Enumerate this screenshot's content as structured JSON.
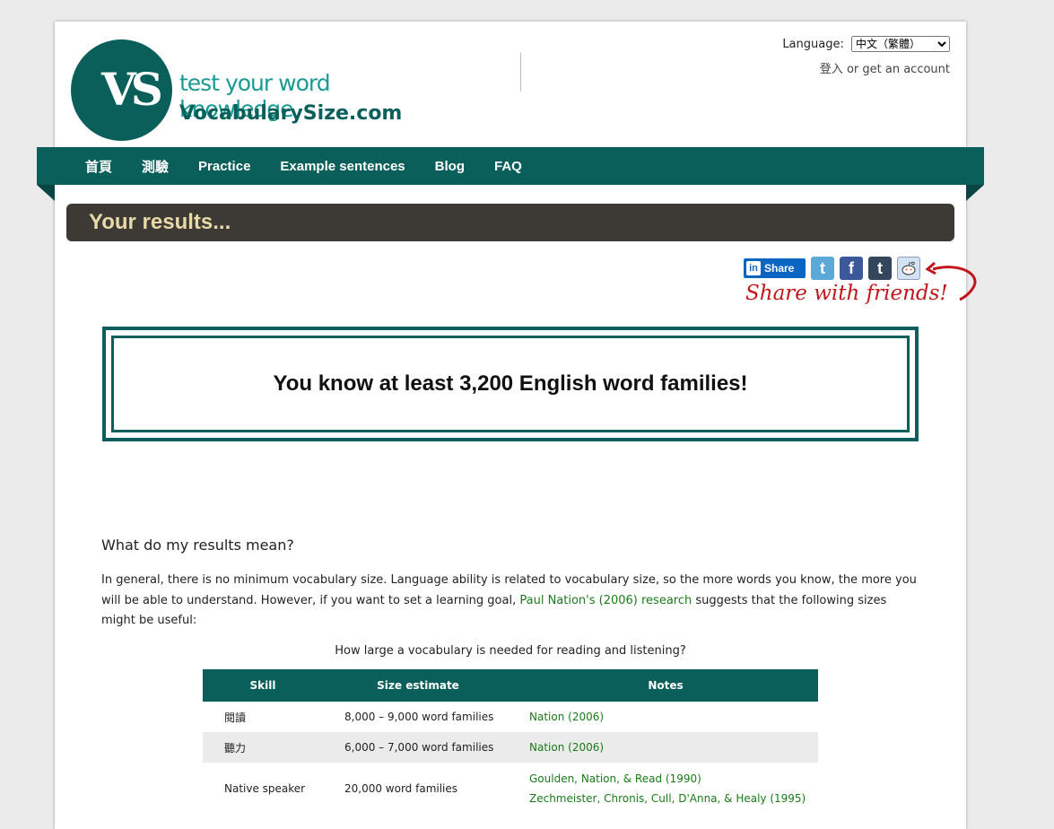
{
  "header": {
    "logo_tagline": "test your word knowledge",
    "logo_domain": "VocabularySize.com",
    "logo_mark": "VS",
    "language_label": "Language:",
    "language_selected": "中文（繁體）",
    "login": "登入",
    "or_text": "or",
    "get_account": "get an account"
  },
  "nav": {
    "items": [
      "首頁",
      "測驗",
      "Practice",
      "Example sentences",
      "Blog",
      "FAQ"
    ]
  },
  "results_title": "Your results...",
  "share": {
    "linkedin_label": "Share",
    "linkedin_icon": "in",
    "twitter_icon": "t",
    "facebook_icon": "f",
    "tumblr_icon": "t",
    "reddit_icon": "reddit",
    "note": "Share with friends!"
  },
  "result_text": "You know at least 3,200 English word families!",
  "meaning": {
    "heading": "What do my results mean?",
    "para_before": "In general, there is no minimum vocabulary size. Language ability is related to vocabulary size, so the more words you know, the more you will be able to understand. However, if you want to set a learning goal, ",
    "para_link": "Paul Nation's (2006) research",
    "para_after": " suggests that the following sizes might be useful:"
  },
  "table": {
    "caption": "How large a vocabulary is needed for reading and listening?",
    "headers": [
      "Skill",
      "Size estimate",
      "Notes"
    ],
    "rows": [
      {
        "skill": "閱讀",
        "size": "8,000 – 9,000 word families",
        "notes": [
          "Nation (2006)"
        ]
      },
      {
        "skill": "聽力",
        "size": "6,000 – 7,000 word families",
        "notes": [
          "Nation (2006)"
        ]
      },
      {
        "skill": "Native speaker",
        "size": "20,000 word families",
        "notes": [
          "Goulden, Nation, & Read (1990)",
          "Zechmeister, Chronis, Cull, D'Anna, & Healy (1995)"
        ]
      }
    ]
  },
  "colors": {
    "brand_teal": "#0b5f5b",
    "results_bar": "#3d3a35",
    "results_title": "#e8d9a8",
    "link_green": "#1a7a1a",
    "note_red": "#c0161c"
  }
}
